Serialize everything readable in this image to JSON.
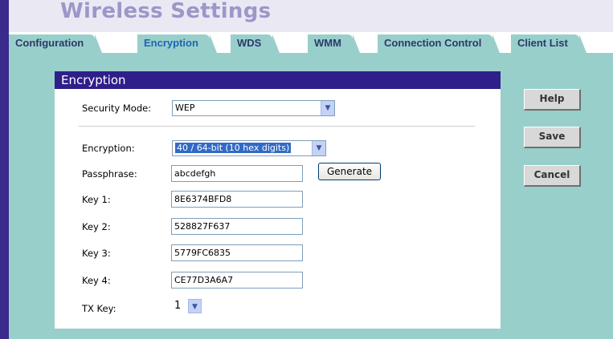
{
  "header": {
    "title": "Wireless Settings"
  },
  "tabs": [
    {
      "label": "Configuration",
      "active": false
    },
    {
      "label": "Encryption",
      "active": true
    },
    {
      "label": "WDS",
      "active": false
    },
    {
      "label": "WMM",
      "active": false
    },
    {
      "label": "Connection Control",
      "active": false
    },
    {
      "label": "Client List",
      "active": false
    }
  ],
  "panel": {
    "title": "Encryption",
    "security_mode": {
      "label": "Security Mode:",
      "value": "WEP"
    },
    "encryption": {
      "label": "Encryption:",
      "value": "40 / 64-bit (10 hex digits)"
    },
    "passphrase": {
      "label": "Passphrase:",
      "value": "abcdefgh"
    },
    "generate_label": "Generate",
    "keys": [
      {
        "label": "Key 1:",
        "value": "8E6374BFD8"
      },
      {
        "label": "Key 2:",
        "value": "528827F637"
      },
      {
        "label": "Key 3:",
        "value": "5779FC6835"
      },
      {
        "label": "Key 4:",
        "value": "CE77D3A6A7"
      }
    ],
    "tx_key": {
      "label": "TX Key:",
      "value": "1"
    }
  },
  "actions": {
    "help": "Help",
    "save": "Save",
    "cancel": "Cancel"
  },
  "colors": {
    "nav_bar": "#3a2a8c",
    "panel_header": "#2e1f8a",
    "content_bg": "#99cfcb",
    "active_tab_text": "#1a66b3",
    "title_text": "#9b97c9"
  }
}
